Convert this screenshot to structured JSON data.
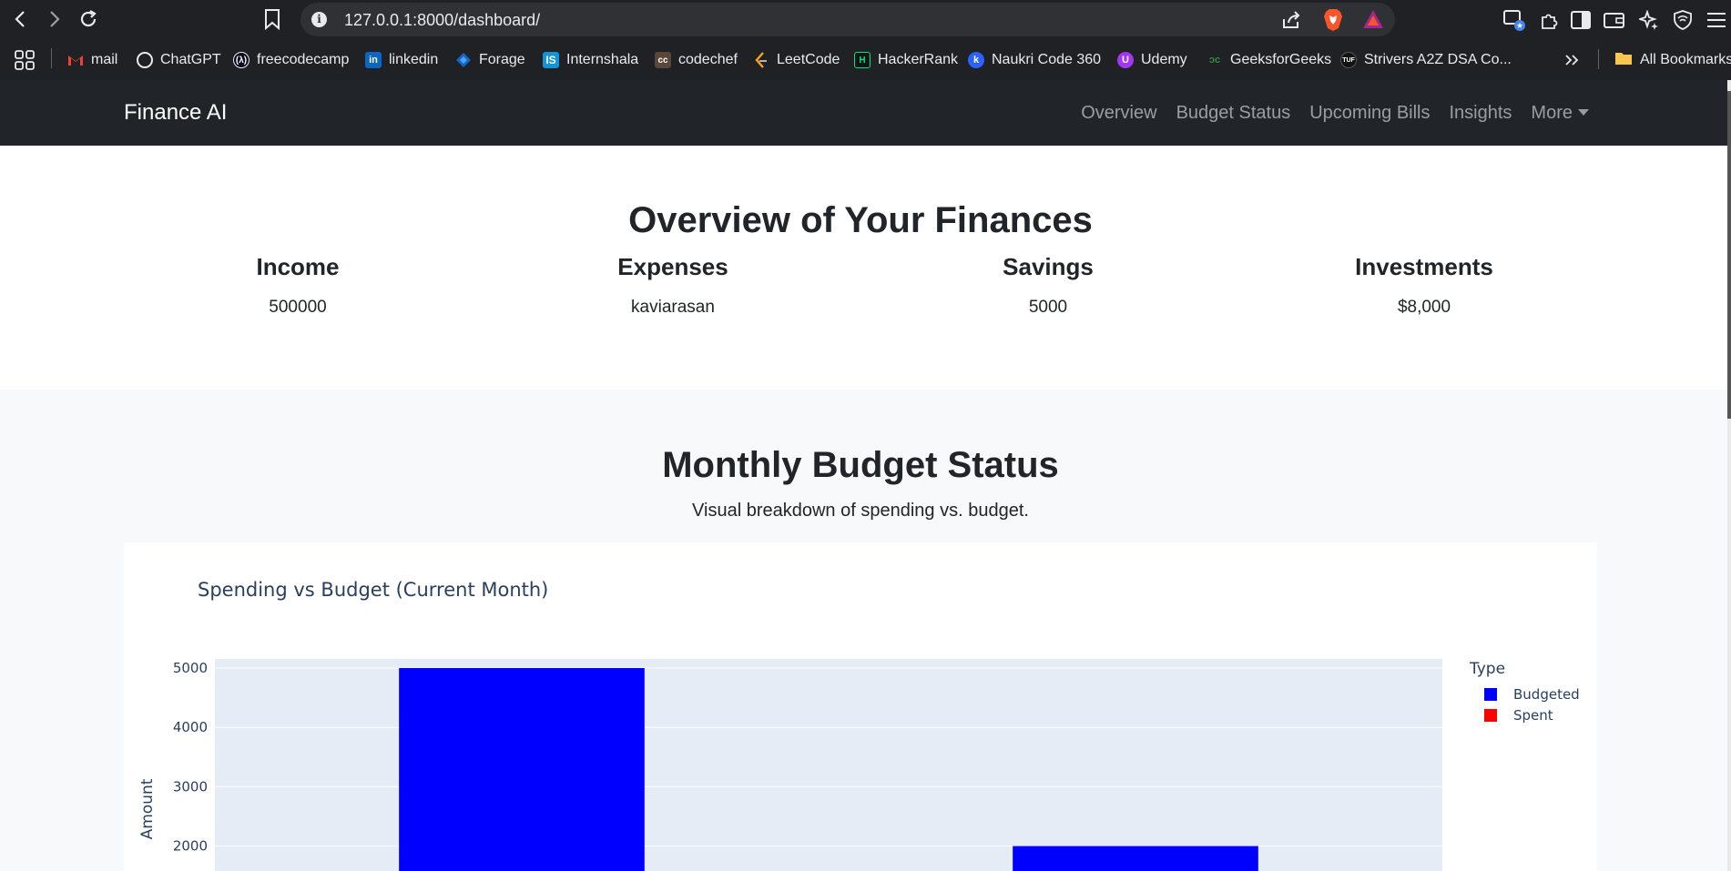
{
  "browser": {
    "url": "127.0.0.1:8000/dashboard/",
    "bookmarks": [
      {
        "label": "mail",
        "icon": "gmail-icon",
        "color": "#ea4335"
      },
      {
        "label": "ChatGPT",
        "icon": "chatgpt-icon",
        "color": "#e8eaed"
      },
      {
        "label": "freecodecamp",
        "icon": "freecodecamp-icon",
        "color": "#0a0a23"
      },
      {
        "label": "linkedin",
        "icon": "linkedin-icon",
        "color": "#0a66c2"
      },
      {
        "label": "Forage",
        "icon": "forage-icon",
        "color": "#1565c0"
      },
      {
        "label": "Internshala",
        "icon": "internshala-icon",
        "color": "#1295d8"
      },
      {
        "label": "codechef",
        "icon": "codechef-icon",
        "color": "#5b4638"
      },
      {
        "label": "LeetCode",
        "icon": "leetcode-icon",
        "color": "#ffa116"
      },
      {
        "label": "HackerRank",
        "icon": "hackerrank-icon",
        "color": "#00ea64"
      },
      {
        "label": "Naukri Code 360",
        "icon": "naukri-icon",
        "color": "#2962ff"
      },
      {
        "label": "Udemy",
        "icon": "udemy-icon",
        "color": "#a435f0"
      },
      {
        "label": "GeeksforGeeks",
        "icon": "geeksforgeeks-icon",
        "color": "#2f8d46"
      },
      {
        "label": "Strivers A2Z DSA Co...",
        "icon": "tuf-icon",
        "color": "#111111"
      }
    ],
    "all_bookmarks": "All Bookmarks"
  },
  "site": {
    "brand": "Finance AI",
    "nav": {
      "overview": "Overview",
      "budget_status": "Budget Status",
      "upcoming_bills": "Upcoming Bills",
      "insights": "Insights",
      "more": "More"
    }
  },
  "overview": {
    "title": "Overview of Your Finances",
    "stats": [
      {
        "label": "Income",
        "value": "500000"
      },
      {
        "label": "Expenses",
        "value": "kaviarasan"
      },
      {
        "label": "Savings",
        "value": "5000"
      },
      {
        "label": "Investments",
        "value": "$8,000"
      }
    ]
  },
  "budget": {
    "title": "Monthly Budget Status",
    "subtitle": "Visual breakdown of spending vs. budget."
  },
  "chart_data": {
    "type": "bar",
    "title": "Spending vs Budget (Current Month)",
    "xlabel": "",
    "ylabel": "Amount",
    "yticks": [
      2000,
      3000,
      4000,
      5000
    ],
    "legend_title": "Type",
    "legend_position": "top-right",
    "grid": true,
    "colors": {
      "Budgeted": "#0000ff",
      "Spent": "#ff0000",
      "plot_bg": "#e5ecf6"
    },
    "series": [
      {
        "name": "Budgeted",
        "values": [
          5000,
          2000
        ]
      },
      {
        "name": "Spent",
        "values": []
      }
    ]
  }
}
